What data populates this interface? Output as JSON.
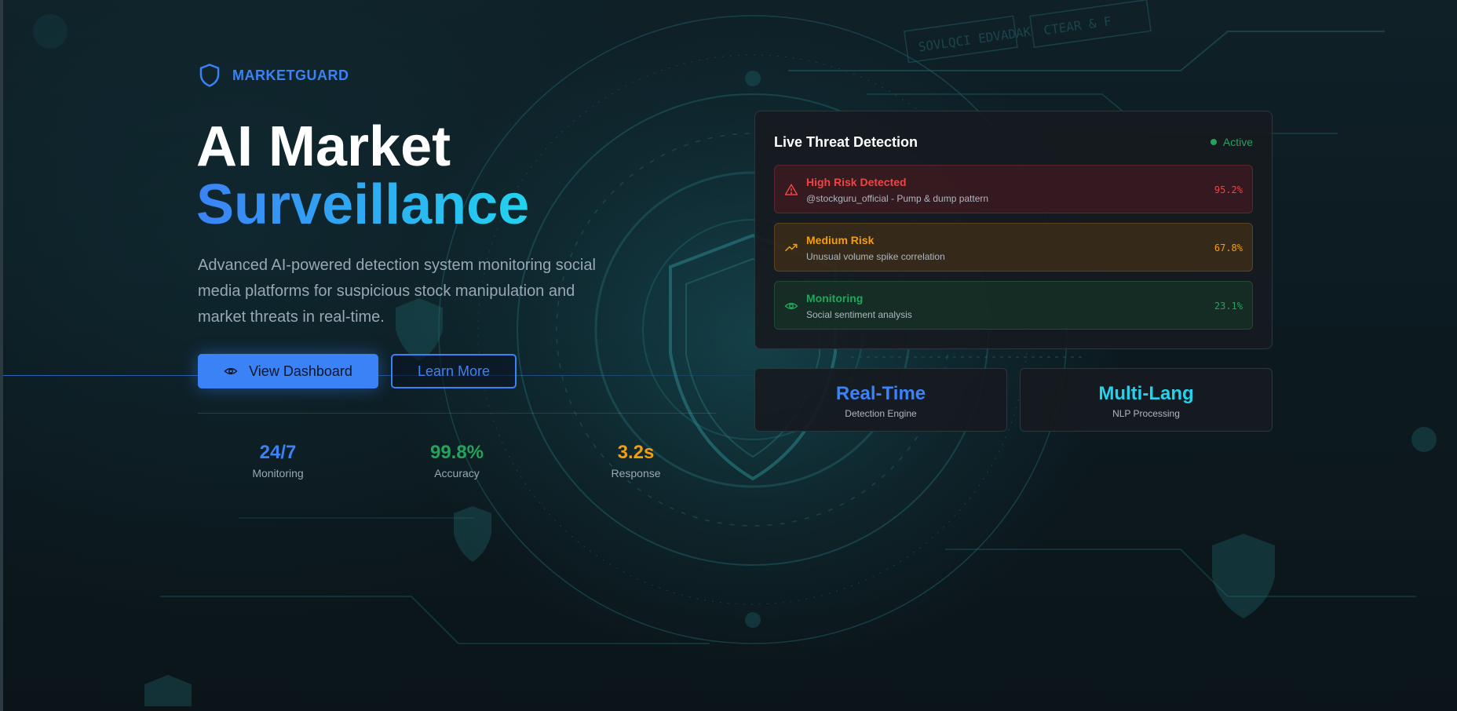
{
  "brand": {
    "name": "MARKETGUARD",
    "icon": "shield-icon",
    "color": "#3b82f6"
  },
  "hero": {
    "title_line1": "AI Market",
    "title_line2": "Surveillance",
    "description": "Advanced AI-powered detection system monitoring social media platforms for suspicious stock manipulation and market threats in real-time."
  },
  "buttons": {
    "primary": {
      "label": "View Dashboard",
      "icon": "eye-icon"
    },
    "secondary": {
      "label": "Learn More"
    }
  },
  "stats": [
    {
      "value": "24/7",
      "label": "Monitoring",
      "color": "#3b82f6"
    },
    {
      "value": "99.8%",
      "label": "Accuracy",
      "color": "#22a55a"
    },
    {
      "value": "3.2s",
      "label": "Response",
      "color": "#f59e0b"
    }
  ],
  "threat_panel": {
    "title": "Live Threat Detection",
    "status": "Active",
    "status_color": "#22a55a",
    "alerts": [
      {
        "level": "high",
        "icon": "warning-triangle-icon",
        "title": "High Risk Detected",
        "description": "@stockguru_official - Pump & dump pattern",
        "score": "95.2%",
        "color": "#ef4444"
      },
      {
        "level": "medium",
        "icon": "trending-up-icon",
        "title": "Medium Risk",
        "description": "Unusual volume spike correlation",
        "score": "67.8%",
        "color": "#f59e0b"
      },
      {
        "level": "low",
        "icon": "eye-icon",
        "title": "Monitoring",
        "description": "Social sentiment analysis",
        "score": "23.1%",
        "color": "#22a55a"
      }
    ]
  },
  "features": [
    {
      "title": "Real-Time",
      "subtitle": "Detection Engine",
      "color": "#3b82f6"
    },
    {
      "title": "Multi-Lang",
      "subtitle": "NLP Processing",
      "color": "#22d3ee"
    }
  ],
  "background_text": [
    "SOVLQCI EDVADAK",
    "CTEAR & F"
  ]
}
